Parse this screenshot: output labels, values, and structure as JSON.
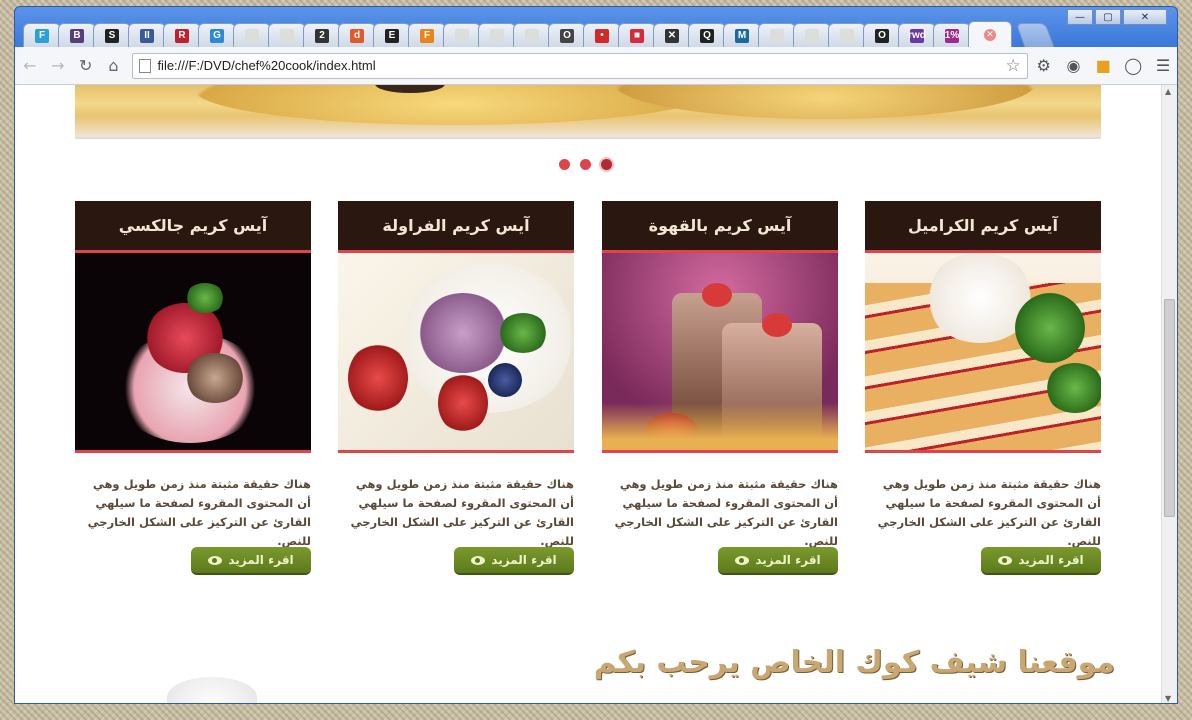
{
  "browser": {
    "url": "file:///F:/DVD/chef%20cook/index.html",
    "tabs": [
      {
        "icon": "F",
        "color": "#2aa0d8"
      },
      {
        "icon": "B",
        "color": "#563d7c"
      },
      {
        "icon": "S",
        "color": "#222222"
      },
      {
        "icon": "II",
        "color": "#3a5a9a"
      },
      {
        "icon": "R",
        "color": "#c0202a"
      },
      {
        "icon": "G",
        "color": "#2a8adc"
      },
      {
        "icon": "",
        "color": "#dddddd"
      },
      {
        "icon": "",
        "color": "#dddddd"
      },
      {
        "icon": "2",
        "color": "#333333"
      },
      {
        "icon": "d",
        "color": "#e05a2a"
      },
      {
        "icon": "E",
        "color": "#222222"
      },
      {
        "icon": "F",
        "color": "#e8841a"
      },
      {
        "icon": "",
        "color": "#dddddd"
      },
      {
        "icon": "",
        "color": "#dddddd"
      },
      {
        "icon": "",
        "color": "#dddddd"
      },
      {
        "icon": "O",
        "color": "#444444"
      },
      {
        "icon": "•",
        "color": "#d02a2a"
      },
      {
        "icon": "■",
        "color": "#d82a3a"
      },
      {
        "icon": "✕",
        "color": "#333333"
      },
      {
        "icon": "Q",
        "color": "#222222"
      },
      {
        "icon": "M",
        "color": "#1a6aa0"
      },
      {
        "icon": "",
        "color": "#dddddd"
      },
      {
        "icon": "",
        "color": "#dddddd"
      },
      {
        "icon": "",
        "color": "#dddddd"
      },
      {
        "icon": "O",
        "color": "#222222"
      },
      {
        "icon": "rwd",
        "color": "#6a3aa0"
      },
      {
        "icon": "1%",
        "color": "#a02a8a"
      }
    ],
    "window_controls": {
      "minimize": "—",
      "maximize": "▢",
      "close": "✕"
    }
  },
  "slider": {
    "dot_count": 3,
    "active_index": 2
  },
  "cards": [
    {
      "title": "آيس كريم جالكسي",
      "text": "هناك حقيقة مثبتة منذ زمن طويل وهي أن المحتوى المقروء لصفحة ما سيلهي القارئ عن التركيز على الشكل الخارجي للنص.",
      "button": "اقرء المزيد"
    },
    {
      "title": "آيس كريم الفراولة",
      "text": "هناك حقيقة مثبتة منذ زمن طويل وهي أن المحتوى المقروء لصفحة ما سيلهي القارئ عن التركيز على الشكل الخارجي للنص.",
      "button": "اقرء المزيد"
    },
    {
      "title": "آيس كريم بالقهوة",
      "text": "هناك حقيقة مثبتة منذ زمن طويل وهي أن المحتوى المقروء لصفحة ما سيلهي القارئ عن التركيز على الشكل الخارجي للنص.",
      "button": "اقرء المزيد"
    },
    {
      "title": "آيس كريم الكراميل",
      "text": "هناك حقيقة مثبتة منذ زمن طويل وهي أن المحتوى المقروء لصفحة ما سيلهي القارئ عن التركيز على الشكل الخارجي للنص.",
      "button": "اقرء المزيد"
    }
  ],
  "welcome": {
    "heading": "موقعنا شيف كوك الخاص يرحب بكم"
  },
  "colors": {
    "accent_red": "#e0434a",
    "header_dark": "#2a1810",
    "button_green": "#6a8a24",
    "heading_gold": "#c9a772"
  }
}
